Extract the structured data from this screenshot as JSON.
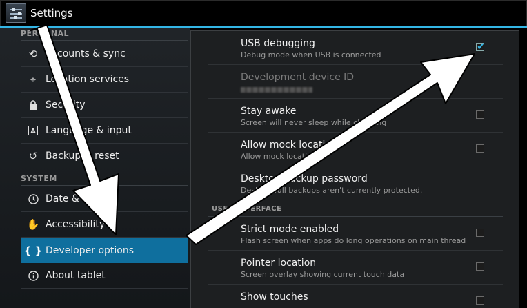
{
  "app": {
    "title": "Settings",
    "icon": "settings-sliders-icon",
    "accent": "#33b5e5"
  },
  "sidebar": {
    "sections": [
      {
        "header": "PERSONAL",
        "items": [
          {
            "label": "Accounts & sync",
            "icon": "sync-icon"
          },
          {
            "label": "Location services",
            "icon": "location-icon"
          },
          {
            "label": "Security",
            "icon": "lock-icon"
          },
          {
            "label": "Language & input",
            "icon": "language-icon"
          },
          {
            "label": "Backup & reset",
            "icon": "backup-icon"
          }
        ]
      },
      {
        "header": "SYSTEM",
        "items": [
          {
            "label": "Date & time",
            "icon": "clock-icon"
          },
          {
            "label": "Accessibility",
            "icon": "hand-icon"
          },
          {
            "label": "Developer options",
            "icon": "braces-icon",
            "active": true
          },
          {
            "label": "About tablet",
            "icon": "info-icon"
          }
        ]
      }
    ]
  },
  "panel": {
    "prefs": [
      {
        "title": "USB debugging",
        "summary": "Debug mode when USB is connected",
        "checked": true
      },
      {
        "title": "Development device ID",
        "summary": "",
        "disabled": true
      },
      {
        "title": "Stay awake",
        "summary": "Screen will never sleep while charging",
        "checked": false
      },
      {
        "title": "Allow mock locations",
        "summary": "Allow mock locations",
        "checked": false
      },
      {
        "title": "Desktop backup password",
        "summary": "Desktop full backups aren't currently protected."
      },
      {
        "title": "Strict mode enabled",
        "summary": "Flash screen when apps do long operations on main thread",
        "checked": false
      },
      {
        "title": "Pointer location",
        "summary": "Screen overlay showing current touch data",
        "checked": false
      },
      {
        "title": "Show touches",
        "summary": "",
        "checked": false
      }
    ],
    "section_user_interface": "USER INTERFACE"
  },
  "annotations": {
    "arrow_color": "#ffffff",
    "arrow_outline": "#000000"
  }
}
